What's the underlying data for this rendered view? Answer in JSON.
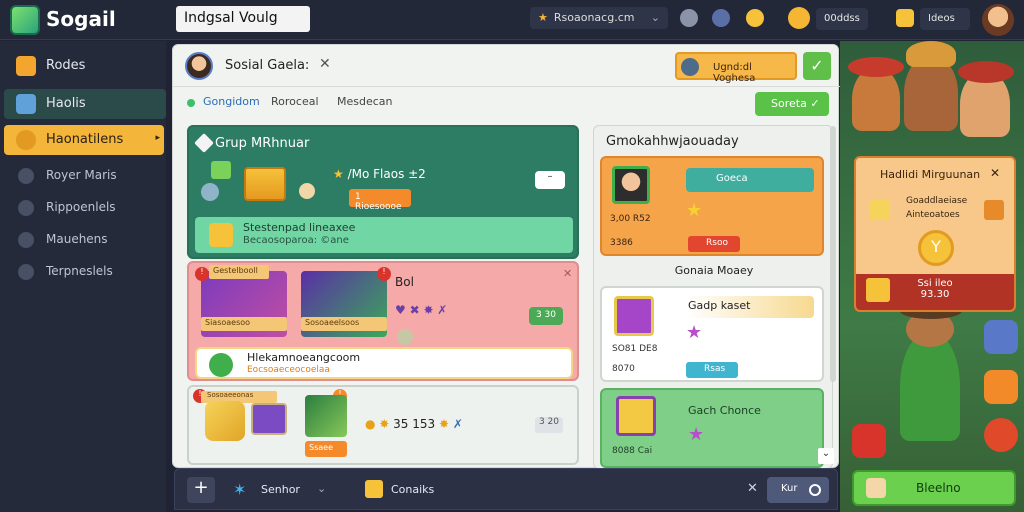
{
  "app": {
    "name": "Sogail",
    "doc_title": "Indgsal Voulg"
  },
  "topbar": {
    "search_text": "Rsoaonacg.cm",
    "pill1": "00ddss",
    "pill2": "Ideos"
  },
  "sidebar": {
    "items": [
      {
        "label": "Rodes"
      },
      {
        "label": "Haolis"
      },
      {
        "label": "Haonatilens"
      },
      {
        "label": "Royer Maris"
      },
      {
        "label": "Rippoenlels"
      },
      {
        "label": "Mauehens"
      },
      {
        "label": "Terpneslels"
      }
    ]
  },
  "panel": {
    "title": "Sosial Gaela:",
    "top_action": "Ugnd:dl Voghesa",
    "tabs": [
      "Gongidom",
      "Roroceal",
      "Mesdecan"
    ],
    "tab_button": "Soreta"
  },
  "card1": {
    "title": "Grup MRhnuar",
    "stat": "/Mo Flaos ±2",
    "pill": "1 Rioesoooe",
    "chip": "–",
    "banner_l1": "Stestenpad lineaxee",
    "banner_l2": "Becaosoparoa: ©ane"
  },
  "card2": {
    "title": "Bol",
    "thumb1_cap": "Siasoaesoo",
    "thumb2_cap": "Sosoaeelsoos",
    "thumb1_tag": "Gestelbooll",
    "icons": "♥ ✖ ✸ ✗",
    "chip": "3 30",
    "banner_l1": "Hlekamnoeangcoom",
    "banner_l2": "Eocsoaeceocoelaa"
  },
  "card3": {
    "tag": "Sosoaeeonas",
    "pill": "Ssaee",
    "stats": "35 153",
    "chip": "3 20"
  },
  "right_col": {
    "title": "Gmokahhwjaouaday",
    "card1": {
      "bar": "Goeca",
      "l1": "3,00 R52",
      "l2": "3386",
      "pill": "Rsoo"
    },
    "subtitle": "Gonaia Moaey",
    "card2": {
      "bar": "Gadp kaset",
      "l1": "SO81 DE8",
      "l2": "8070",
      "pill": "Rsas"
    },
    "card3": {
      "title": "Gach Chonce",
      "l1": "8088 Cai"
    }
  },
  "float_card": {
    "title": "Hadlidi Mirguunan",
    "l1": "Goaddlaeiase",
    "l2": "Ainteoatoes",
    "red_l1": "Ssi ileo",
    "red_l2": "93.30"
  },
  "bottom_right_button": "Bleelno",
  "bottombar": {
    "item1": "Senhor",
    "item2": "Conaiks",
    "pill": "Kur"
  }
}
